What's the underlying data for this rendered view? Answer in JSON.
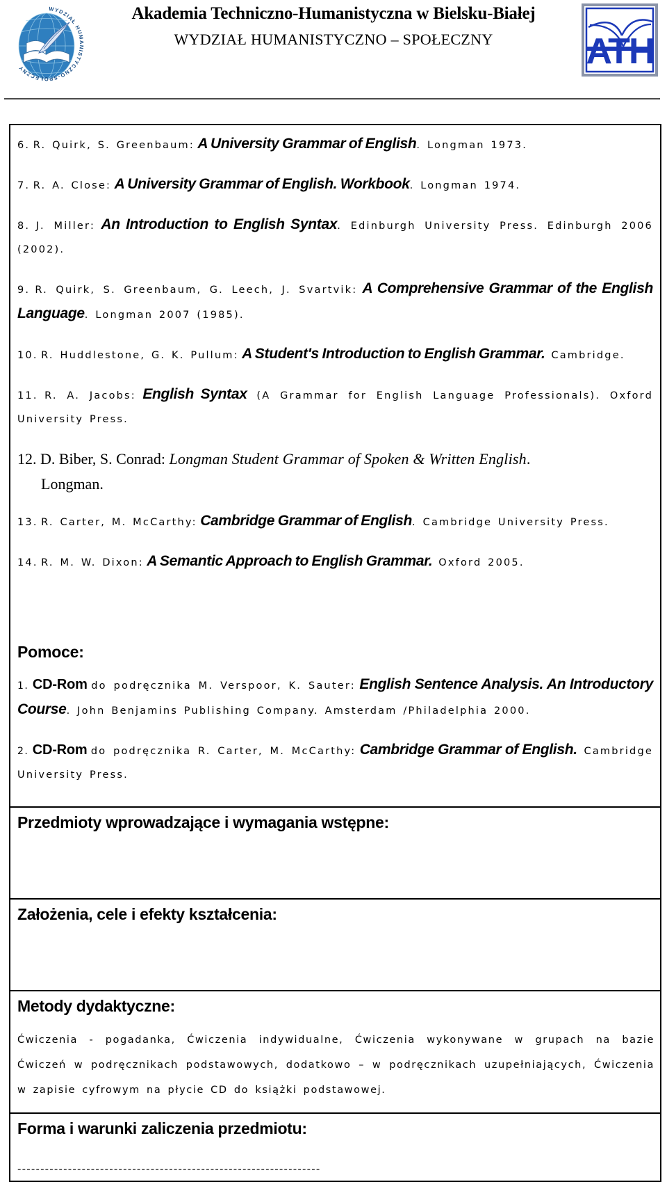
{
  "header": {
    "university_title": "Akademia Techniczno-Humanistyczna w Bielsku-Białej",
    "faculty_title": "WYDZIAŁ HUMANISTYCZNO – SPOŁECZNY",
    "left_logo_ring_text": "WYDZIAŁ HUMANISTYCZNO-SPOŁECZNY",
    "right_logo_text": "ATH",
    "logo_blue": "#1c39b8",
    "logo_globe_blue": "#2272b8"
  },
  "bibliography": [
    {
      "num": "6.",
      "authors": "R. Quirk, S. Greenbaum:",
      "title": "A University Grammar of English",
      "rest": ". Longman  1973."
    },
    {
      "num": "7.",
      "authors": "R. A. Close:",
      "title": "A University Grammar of English. Workbook",
      "rest": ". Longman  1974."
    },
    {
      "num": "8.",
      "authors": "J. Miller:",
      "title": "An Introduction to English Syntax",
      "rest": ". Edinburgh  University  Press.  Edinburgh  2006 (2002)."
    },
    {
      "num": "9.",
      "authors": "R. Quirk, S. Greenbaum,  G. Leech,  J. Svartvik:",
      "title": "A Comprehensive Grammar of the English Language",
      "rest": ". Longman  2007  (1985)."
    },
    {
      "num": "10.",
      "authors": "R.  Huddlestone,  G.  K.  Pullum:",
      "title": "A Student's Introduction to English Grammar.",
      "rest": " Cambridge."
    },
    {
      "num": "11.",
      "authors": "R. A. Jacobs:",
      "title": "English Syntax",
      "rest": " (A Grammar  for  English  Language  Professionals).  Oxford University  Press."
    },
    {
      "num": "13.",
      "authors": "R. Carter, M. McCarthy:",
      "title": "Cambridge Grammar of English",
      "rest": ". Cambridge  University  Press."
    },
    {
      "num": "14.",
      "authors": "R.  M.  W.  Dixon:",
      "title": "A Semantic Approach to English Grammar.",
      "rest": " Oxford  2005."
    }
  ],
  "bibliography_serif": {
    "num": "12.",
    "authors": "D. Biber, S. Conrad:",
    "title": "Longman Student Grammar of Spoken & Written English",
    "rest": ".",
    "continuation": "Longman."
  },
  "pomoce": {
    "heading": "Pomoce:",
    "items": [
      {
        "num": "1.",
        "media": "CD-Rom",
        "lead": "do  podręcznika  M.  Verspoor,  K.  Sauter:",
        "title": "English Sentence Analysis. An Introductory Course",
        "rest": ". John  Benjamins  Publishing  Company.  Amsterdam  /Philadelphia  2000."
      },
      {
        "num": "2.",
        "media": "CD-Rom",
        "lead": "do  podręcznika  R.  Carter,  M.  McCarthy:",
        "title": "Cambridge Grammar of English.",
        "rest": " Cambridge  University  Press."
      }
    ]
  },
  "sections": [
    {
      "heading": "Przedmioty wprowadzające i wymagania wstępne:",
      "body": ""
    },
    {
      "heading": "Założenia, cele i efekty kształcenia:",
      "body": ""
    },
    {
      "heading": "Metody dydaktyczne:",
      "body_plain": "Ćwiczenia - pogadanka, Ćwiczenia indywidualne, Ćwiczenia wykonywane w grupach na bazie Ćwiczeń w podręcznikach podstawowych, dodatkowo – w podręcznikach uzupełniających, Ćwiczenia w zapisie cyfrowym  na płycie CD do książki podstawowej."
    },
    {
      "heading": "Forma i warunki zaliczenia przedmiotu:",
      "dashes": "------------------------------------------------------------------"
    }
  ]
}
